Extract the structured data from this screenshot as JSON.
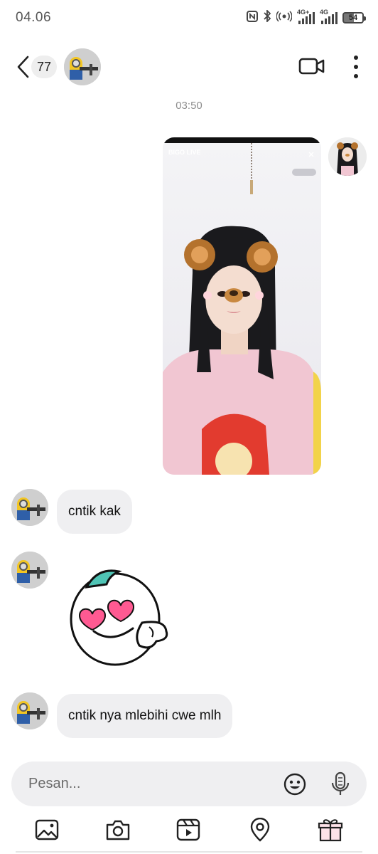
{
  "status_bar": {
    "time": "04.06",
    "network_1": "4G+",
    "network_2": "4G",
    "battery": "54"
  },
  "header": {
    "back_icon": "chevron-left-icon",
    "unread_count": "77",
    "contact_avatar": "minion-avatar",
    "video_call_icon": "video-camera-icon",
    "more_icon": "vertical-dots-icon"
  },
  "conversation": {
    "timestamp": "03:50",
    "sent_photo": {
      "overlay_brand": "BIGO LIVE",
      "description_icon": "photo-message"
    },
    "messages": [
      {
        "from": "contact",
        "type": "text",
        "text": "cntik kak"
      },
      {
        "from": "contact",
        "type": "sticker",
        "sticker": "heart-eyes-sticker"
      },
      {
        "from": "contact",
        "type": "text",
        "text": "cntik nya mlebihi cwe mlh"
      }
    ]
  },
  "composer": {
    "placeholder": "Pesan...",
    "emoji_icon": "smiley-icon",
    "mic_icon": "microphone-icon"
  },
  "toolbar": {
    "items": [
      "gallery-icon",
      "camera-icon",
      "reels-icon",
      "location-icon",
      "gift-icon"
    ]
  },
  "colors": {
    "bubble_bg": "#efeff1",
    "timestamp": "#8e8e8e",
    "sticker_heart": "#ff5a92",
    "sticker_cap": "#4fc4b5"
  }
}
